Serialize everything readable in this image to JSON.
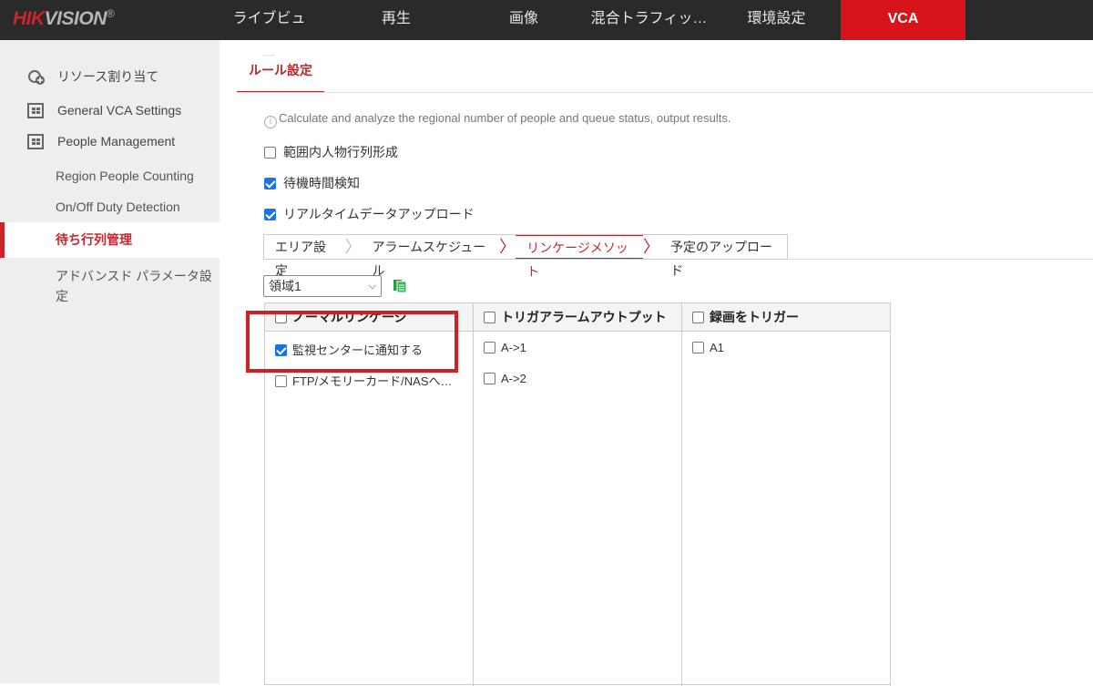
{
  "header": {
    "logo": "HIKVISION",
    "nav": [
      "ライブビュー",
      "再生",
      "画像",
      "混合トラフィッ…",
      "環境設定",
      "VCA"
    ],
    "active": "VCA"
  },
  "sidebar": {
    "items": [
      {
        "label": "リソース割り当て",
        "icon": "resource-icon"
      },
      {
        "label": "General VCA Settings",
        "icon": "grid-icon"
      },
      {
        "label": "People Management",
        "icon": "grid-icon"
      },
      {
        "label": "Region People Counting"
      },
      {
        "label": "On/Off Duty Detection"
      },
      {
        "label": "待ち行列管理",
        "active": true
      },
      {
        "label": "アドバンスド パラメータ設定"
      }
    ]
  },
  "main": {
    "tab": "ルール設定",
    "info": "Calculate and analyze the regional number of people and queue status, output results.",
    "options": [
      {
        "label": "範囲内人物行列形成",
        "checked": false
      },
      {
        "label": "待機時間検知",
        "checked": true
      },
      {
        "label": "リアルタイムデータアップロード",
        "checked": true
      }
    ],
    "steps": [
      "エリア設定",
      "アラームスケジュール",
      "リンケージメソット",
      "予定のアップロード"
    ],
    "region_select": "領域1",
    "table": {
      "columns": [
        {
          "header": "ノーマルリンケージ",
          "items": [
            {
              "label": "監視センターに通知する",
              "checked": true
            },
            {
              "label": "FTP/メモリーカード/NASへ…",
              "checked": false
            }
          ]
        },
        {
          "header": "トリガアラームアウトプット",
          "items": [
            {
              "label": "A->1",
              "checked": false
            },
            {
              "label": "A->2",
              "checked": false
            }
          ]
        },
        {
          "header": "録画をトリガー",
          "items": [
            {
              "label": "A1",
              "checked": false
            }
          ]
        }
      ]
    }
  },
  "colors": {
    "accent": "#c8252c",
    "header_bg": "#2a2a2a",
    "sidebar_bg": "#eeeeee"
  }
}
